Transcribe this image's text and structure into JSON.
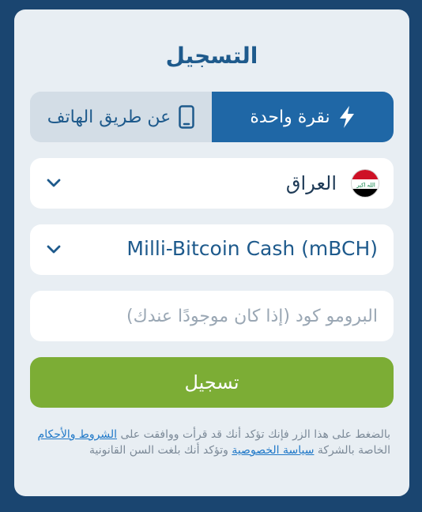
{
  "title": "التسجيل",
  "tabs": {
    "one_click": "نقرة واحدة",
    "phone": "عن طريق الهاتف"
  },
  "country": {
    "label": "العراق",
    "flag_text": "الله اكبر"
  },
  "currency": {
    "label": "Milli-Bitcoin Cash (mBCH)"
  },
  "promo": {
    "placeholder": "البرومو كود (إذا كان موجودًا عندك)",
    "value": ""
  },
  "submit_label": "تسجيل",
  "terms": {
    "part1": "بالضغط على هذا الزر فإنك تؤكد أنك قد قرأت ووافقت على ",
    "link_terms": "الشروط والأحكام",
    "part2": " الخاصة بالشركة ",
    "link_privacy": "سياسة الخصوصية",
    "part3": " وتؤكد أنك بلغت السن القانونية"
  },
  "colors": {
    "background": "#1a4570",
    "card": "#e8eef3",
    "accent": "#1f67a6",
    "title": "#1e5a8c",
    "submit": "#7cad35",
    "link": "#1f78c8"
  },
  "icons": {
    "one_click": "lightning-icon",
    "phone": "smartphone-icon",
    "dropdown": "chevron-down-icon"
  }
}
